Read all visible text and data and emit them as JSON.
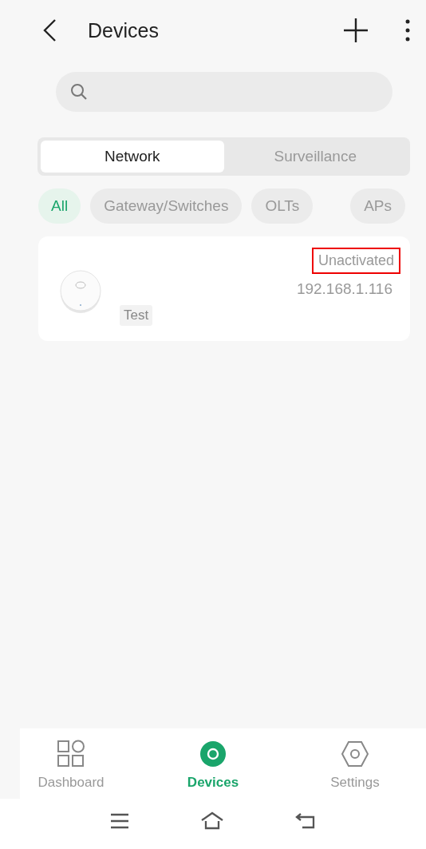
{
  "header": {
    "title": "Devices"
  },
  "segments": [
    {
      "label": "Network",
      "selected": true
    },
    {
      "label": "Surveillance",
      "selected": false
    }
  ],
  "filters": [
    {
      "label": "All",
      "selected": true
    },
    {
      "label": "Gateway/Switches",
      "selected": false
    },
    {
      "label": "OLTs",
      "selected": false
    },
    {
      "label": "APs",
      "selected": false
    }
  ],
  "devices": [
    {
      "status": "Unactivated",
      "status_highlighted": true,
      "ip": "192.168.1.116",
      "tag": "Test"
    }
  ],
  "bottom_nav": [
    {
      "label": "Dashboard",
      "kind": "dashboard",
      "selected": false
    },
    {
      "label": "Devices",
      "kind": "devices",
      "selected": true
    },
    {
      "label": "Settings",
      "kind": "settings",
      "selected": false
    }
  ]
}
